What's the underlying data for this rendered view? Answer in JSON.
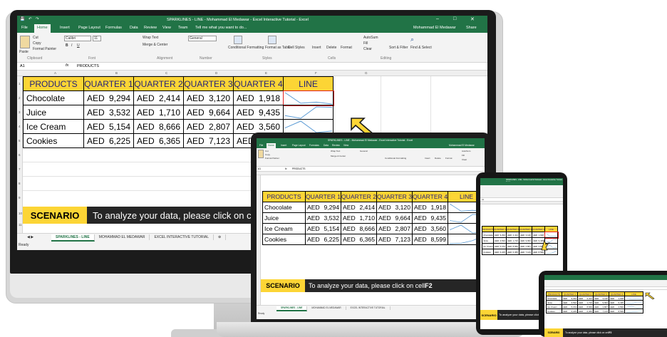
{
  "window": {
    "title": "SPARKLINES - LINE - Mohammad El Medawar - Excel Interactive Tutorial - Excel",
    "user": "Mohammad El Medawar",
    "share": "Share"
  },
  "ribbon_tabs": [
    "File",
    "Home",
    "Insert",
    "Page Layout",
    "Formulas",
    "Data",
    "Review",
    "View",
    "Team"
  ],
  "tell_me": "Tell me what you want to do...",
  "ribbon": {
    "cut": "Cut",
    "copy": "Copy",
    "paste": "Paste",
    "format_painter": "Format Painter",
    "font_name": "Calibri",
    "font_size": "11",
    "wrap_text": "Wrap Text",
    "merge_center": "Merge & Center",
    "number_format": "General",
    "conditional_formatting": "Conditional Formatting",
    "format_as_table": "Format as Table",
    "cell_styles": "Cell Styles",
    "insert": "Insert",
    "delete": "Delete",
    "format": "Format",
    "autosum": "AutoSum",
    "fill": "Fill",
    "clear": "Clear",
    "sort_filter": "Sort & Filter",
    "find_select": "Find & Select",
    "groups": [
      "Clipboard",
      "Font",
      "Alignment",
      "Number",
      "Styles",
      "Cells",
      "Editing"
    ]
  },
  "formula_bar": {
    "name_box": "A1",
    "fx": "fx",
    "content": "PRODUCTS"
  },
  "columns": [
    "A",
    "B",
    "C",
    "D",
    "E",
    "F",
    "G"
  ],
  "rows": [
    "1",
    "2",
    "3",
    "4",
    "5",
    "6",
    "7",
    "8",
    "9",
    "10",
    "11",
    "12"
  ],
  "table": {
    "headers": [
      "PRODUCTS",
      "QUARTER 1",
      "QUARTER 2",
      "QUARTER 3",
      "QUARTER 4",
      "LINE"
    ],
    "rows": [
      {
        "product": "Chocolate",
        "values": [
          [
            "AED",
            "9,294"
          ],
          [
            "AED",
            "2,414"
          ],
          [
            "AED",
            "3,120"
          ],
          [
            "AED",
            "1,918"
          ]
        ]
      },
      {
        "product": "Juice",
        "values": [
          [
            "AED",
            "3,532"
          ],
          [
            "AED",
            "1,710"
          ],
          [
            "AED",
            "9,664"
          ],
          [
            "AED",
            "9,435"
          ]
        ]
      },
      {
        "product": "Ice Cream",
        "values": [
          [
            "AED",
            "5,154"
          ],
          [
            "AED",
            "8,666"
          ],
          [
            "AED",
            "2,807"
          ],
          [
            "AED",
            "3,560"
          ]
        ]
      },
      {
        "product": "Cookies",
        "values": [
          [
            "AED",
            "6,225"
          ],
          [
            "AED",
            "6,365"
          ],
          [
            "AED",
            "7,123"
          ],
          [
            "AED",
            "8,599"
          ]
        ]
      }
    ]
  },
  "scenario": {
    "tag": "SCENARIO",
    "text_prefix": "To analyze your data, please click on cell ",
    "cell": "F2"
  },
  "sheet_tabs": [
    "SPARKLINES - LINE",
    "MOHAMMAD EL MEDAWAR",
    "EXCEL INTERACTIVE TUTORIAL"
  ],
  "status": "Ready",
  "colors": {
    "excel_green": "#217346",
    "header_yellow": "#fcd535",
    "header_text": "#1f1f7a",
    "arrow_yellow": "#fcd535",
    "selection_red": "#e02020",
    "scenario_bg": "#262626"
  },
  "icons": [
    "save-icon",
    "undo-icon",
    "redo-icon",
    "minimize-icon",
    "maximize-icon",
    "close-icon",
    "share-icon",
    "search-icon",
    "arrow-pointer-icon"
  ]
}
